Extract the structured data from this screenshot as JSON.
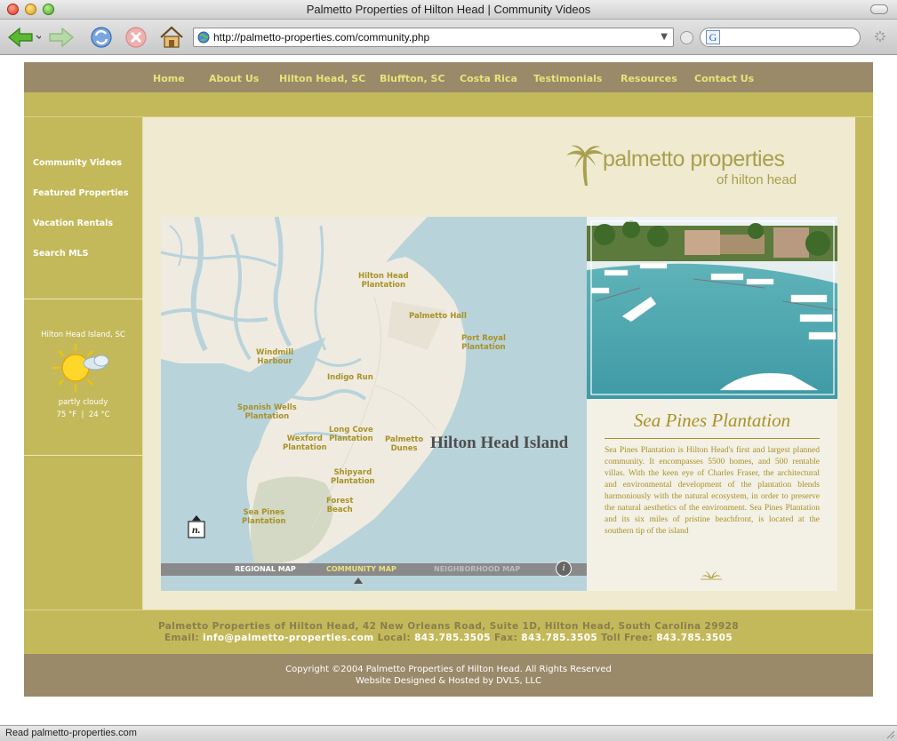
{
  "window": {
    "title": "Palmetto Properties of Hilton Head | Community Videos"
  },
  "toolbar": {
    "url": "http://palmetto-properties.com/community.php",
    "search_engine_glyph": "G"
  },
  "nav": {
    "items": [
      "Home",
      "About Us",
      "Hilton Head, SC",
      "Bluffton, SC",
      "Costa Rica",
      "Testimonials",
      "Resources",
      "Contact Us"
    ]
  },
  "sidebar": {
    "links": [
      "Community Videos",
      "Featured Properties",
      "Vacation Rentals",
      "Search MLS"
    ]
  },
  "weather": {
    "location": "Hilton Head Island, SC",
    "condition": "partly cloudy",
    "temp_f": "75",
    "unit_f": "°F",
    "temp_c": "24",
    "unit_c": "°C",
    "icon": "partly-cloudy-sun-icon"
  },
  "logo": {
    "main": "palmetto properties",
    "sub": "of hilton head"
  },
  "map": {
    "title": "Hilton Head Island",
    "north_glyph": "n.",
    "info_glyph": "i",
    "labels": {
      "hilton_head": "Hilton Head\nPlantation",
      "palmetto_hall": "Palmetto Hall",
      "port_royal": "Port Royal\nPlantation",
      "windmill": "Windmill\nHarbour",
      "indigo": "Indigo Run",
      "spanish_wells": "Spanish Wells\nPlantation",
      "long_cove": "Long Cove\nPlantation",
      "wexford": "Wexford\nPlantation",
      "palmetto_dunes": "Palmetto\nDunes",
      "shipyard": "Shipyard\nPlantation",
      "forest_beach": "Forest\nBeach",
      "sea_pines": "Sea Pines\nPlantation"
    },
    "tabs": {
      "regional": "REGIONAL MAP",
      "community": "COMMUNITY MAP",
      "neighborhood": "NEIGHBORHOOD MAP"
    },
    "colors": {
      "water": "#b9d3db",
      "land": "#f0ece2",
      "highlight": "#d8dcc8",
      "label": "#a89226"
    }
  },
  "info": {
    "title": "Sea Pines Plantation",
    "body": "Sea Pines Plantation is Hilton Head's first and largest planned community. It encompasses 5500 homes, and 500 rentable villas. With the keen eye of Charles Fraser, the architectural and environmental development of the plantation blends harmoniously with the natural ecosystem, in order to preserve the natural aesthetics of the environment. Sea Pines Plantation and its six miles of pristine beachfront, is located at the southern tip of the island"
  },
  "footer": {
    "address": "Palmetto Properties of Hilton Head, 42 New Orleans Road, Suite 1D, Hilton Head, South Carolina 29928",
    "email_label": "Email:",
    "email": "info@palmetto-properties.com",
    "local_label": "Local:",
    "local": "843.785.3505",
    "fax_label": "Fax:",
    "fax": "843.785.3505",
    "tollfree_label": "Toll Free:",
    "tollfree": "843.785.3505",
    "copyright": "Copyright ©2004 Palmetto Properties of Hilton Head. All Rights Reserved",
    "designed": "Website Designed & Hosted by DVLS, LLC"
  },
  "status": {
    "text": "Read palmetto-properties.com"
  },
  "colors": {
    "nav_bg": "#9a8a6a",
    "olive": "#c4b95a",
    "nav_text": "#e9e27a",
    "cream": "#efead0",
    "gold_text": "#a89226"
  }
}
